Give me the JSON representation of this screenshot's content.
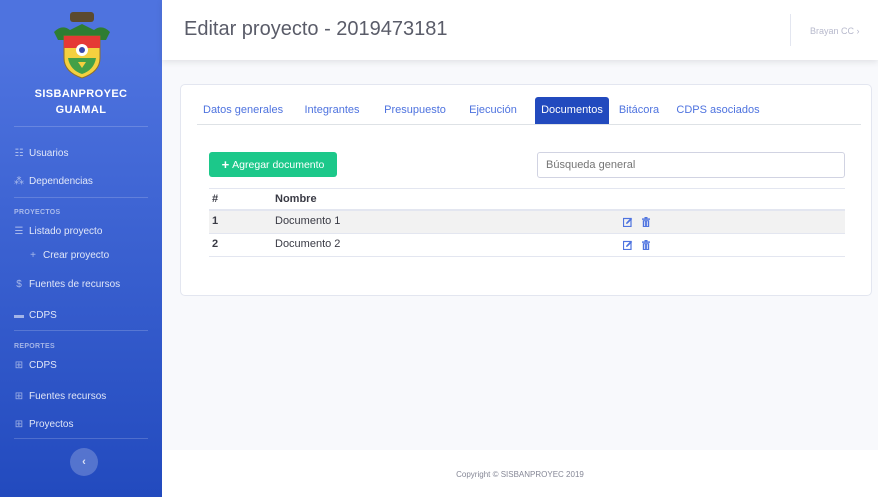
{
  "sidebar": {
    "brand_line1": "SISBANPROYEC",
    "brand_line2": "GUAMAL",
    "items": [
      {
        "label": "Usuarios",
        "icon": "users-icon"
      },
      {
        "label": "Dependencias",
        "icon": "sitemap-icon"
      }
    ],
    "heading_proyectos": "PROYECTOS",
    "proyectos_items": [
      {
        "label": "Listado proyecto",
        "icon": "list-icon"
      },
      {
        "label": "Crear proyecto",
        "icon": "plus-icon"
      },
      {
        "label": "Fuentes de recursos",
        "icon": "dollar-icon"
      },
      {
        "label": "CDPS",
        "icon": "card-icon"
      }
    ],
    "heading_reportes": "REPORTES",
    "reportes_items": [
      {
        "label": "CDPS",
        "icon": "table-icon"
      },
      {
        "label": "Fuentes recursos",
        "icon": "table-icon"
      },
      {
        "label": "Proyectos",
        "icon": "table-icon"
      }
    ],
    "toggle_glyph": "‹"
  },
  "topbar": {
    "title": "Editar proyecto - 2019473181",
    "user": "Brayan CC ›"
  },
  "tabs": [
    {
      "label": "Datos generales",
      "active": false
    },
    {
      "label": "Integrantes",
      "active": false
    },
    {
      "label": "Presupuesto",
      "active": false
    },
    {
      "label": "Ejecución",
      "active": false
    },
    {
      "label": "Documentos",
      "active": true
    },
    {
      "label": "Bitácora",
      "active": false
    },
    {
      "label": "CDPS asociados",
      "active": false
    }
  ],
  "documents": {
    "add_button": "Agregar documento",
    "add_glyph": "+",
    "search_placeholder": "Búsqueda general",
    "columns": [
      "#",
      "Nombre"
    ],
    "rows": [
      {
        "num": "1",
        "name": "Documento 1"
      },
      {
        "num": "2",
        "name": "Documento 2"
      }
    ]
  },
  "footer": {
    "copyright": "Copyright © SISBANPROYEC 2019"
  },
  "colors": {
    "sidebar_top": "#4e73df",
    "sidebar_bottom": "#224abe",
    "active_tab": "#224abe",
    "add_button": "#1cc88a",
    "edit_icon": "#4e73df",
    "delete_icon": "#4e73df"
  }
}
